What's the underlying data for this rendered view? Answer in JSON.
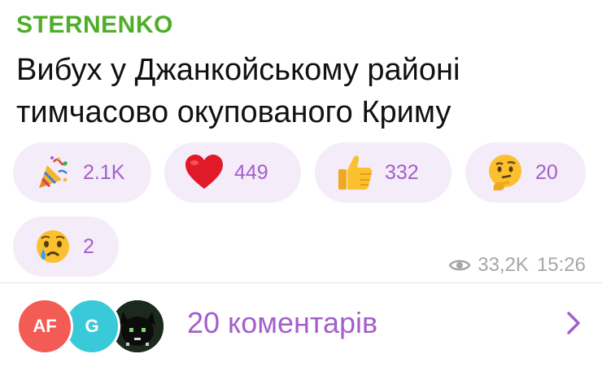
{
  "channel": {
    "name": "STERNENKO"
  },
  "message": {
    "line1": "Вибух у Джанкойському районі",
    "line2": "тимчасово окупованого Криму"
  },
  "reactions": [
    {
      "icon": "party-popper-icon",
      "count": "2.1K"
    },
    {
      "icon": "red-heart-icon",
      "count": "449"
    },
    {
      "icon": "thumbs-up-icon",
      "count": "332"
    },
    {
      "icon": "thinking-face-icon",
      "count": "20"
    },
    {
      "icon": "crying-face-icon",
      "count": "2"
    }
  ],
  "meta": {
    "views": "33,2K",
    "time": "15:26"
  },
  "comments": {
    "avatars": [
      {
        "initials": "AF"
      },
      {
        "initials": "G"
      },
      {
        "initials": ""
      }
    ],
    "label": "20 коментарів"
  },
  "colors": {
    "channel": "#4fae28",
    "accent": "#a35fcc",
    "reaction_bg": "#f4ecf9",
    "meta": "#a6a6aa"
  }
}
